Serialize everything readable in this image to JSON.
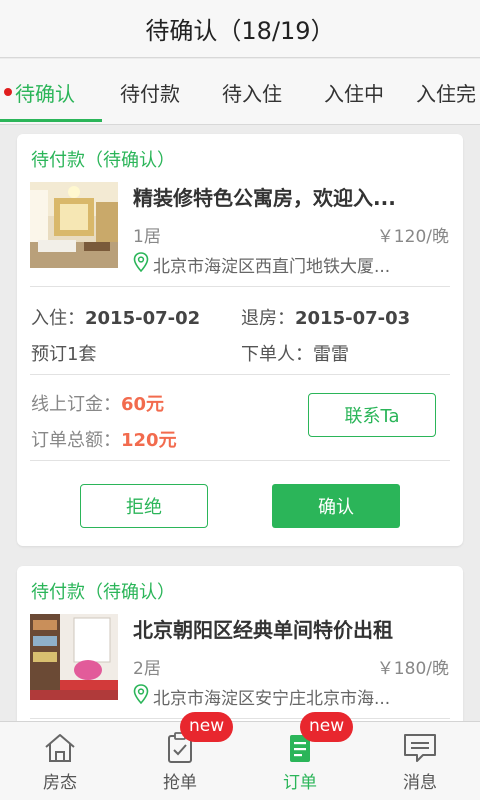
{
  "header": {
    "title": "待确认（18/19）"
  },
  "tabs": [
    {
      "label": "待确认",
      "active": true
    },
    {
      "label": "待付款"
    },
    {
      "label": "待入住"
    },
    {
      "label": "入住中"
    },
    {
      "label": "入住完"
    }
  ],
  "orders": [
    {
      "status": "待付款（待确认）",
      "name": "精装修特色公寓房，欢迎入...",
      "rooms": "1居",
      "price": "￥120/晚",
      "address": "北京市海淀区西直门地铁大厦...",
      "checkin_label": "入住：",
      "checkin": "2015-07-02",
      "checkout_label": "退房：",
      "checkout": "2015-07-03",
      "booking": "预订1套",
      "orderer_label": "下单人：",
      "orderer": "雷雷",
      "deposit_label": "线上订金：",
      "deposit": "60元",
      "total_label": "订单总额：",
      "total": "120元",
      "contact_label": "联系Ta",
      "reject_label": "拒绝",
      "confirm_label": "确认"
    },
    {
      "status": "待付款（待确认）",
      "name": "北京朝阳区经典单间特价出租",
      "rooms": "2居",
      "price": "￥180/晚",
      "address": "北京市海淀区安宁庄北京市海..."
    }
  ],
  "bottom_nav": [
    {
      "label": "房态",
      "icon": "house-icon"
    },
    {
      "label": "抢单",
      "icon": "clipboard-icon",
      "badge": "new"
    },
    {
      "label": "订单",
      "icon": "order-icon",
      "badge": "new",
      "active": true
    },
    {
      "label": "消息",
      "icon": "message-icon"
    }
  ],
  "colors": {
    "accent": "#2bb559",
    "badge": "#e8272e",
    "money": "#f26b4e"
  }
}
